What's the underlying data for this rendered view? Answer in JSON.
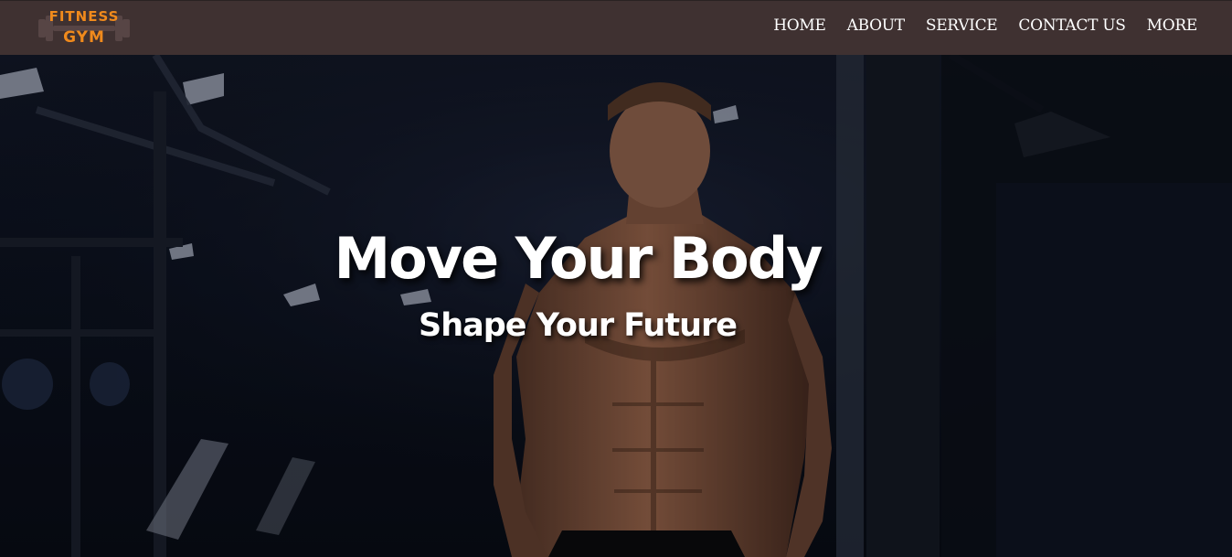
{
  "logo": {
    "line1": "FITNESS",
    "line2": "GYM",
    "icon": "dumbbell-icon",
    "color": "#f08a1c"
  },
  "nav": {
    "items": [
      {
        "label": "HOME"
      },
      {
        "label": "ABOUT"
      },
      {
        "label": "SERVICE"
      },
      {
        "label": "CONTACT US"
      },
      {
        "label": "MORE"
      }
    ],
    "background": "#3f3131"
  },
  "hero": {
    "title": "Move Your Body",
    "subtitle": "Shape Your Future",
    "image": "gym-athlete-photo"
  }
}
